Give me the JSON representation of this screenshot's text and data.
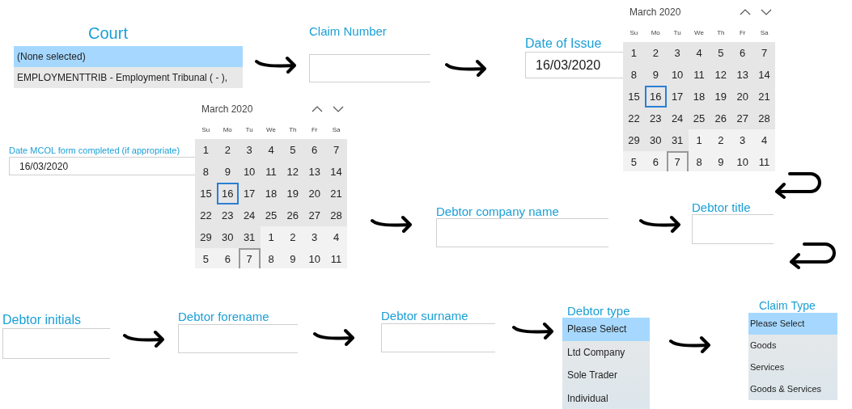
{
  "court": {
    "label": "Court",
    "options": [
      {
        "label": "(None selected)",
        "selected": true
      },
      {
        "label": "EMPLOYMENTTRIB - Employment Tribunal ( - ),",
        "selected": false
      }
    ]
  },
  "claim_number": {
    "label": "Claim Number"
  },
  "date_of_issue": {
    "label": "Date of Issue",
    "value": "16/03/2020"
  },
  "date_of_issue_calendar": {
    "month": "March 2020",
    "weekdays": [
      "Su",
      "Mo",
      "Tu",
      "We",
      "Th",
      "Fr",
      "Sa"
    ],
    "days": [
      {
        "label": "1",
        "in_month": true,
        "selected": false,
        "focused": false
      },
      {
        "label": "2",
        "in_month": true,
        "selected": false,
        "focused": false
      },
      {
        "label": "3",
        "in_month": true,
        "selected": false,
        "focused": false
      },
      {
        "label": "4",
        "in_month": true,
        "selected": false,
        "focused": false
      },
      {
        "label": "5",
        "in_month": true,
        "selected": false,
        "focused": false
      },
      {
        "label": "6",
        "in_month": true,
        "selected": false,
        "focused": false
      },
      {
        "label": "7",
        "in_month": true,
        "selected": false,
        "focused": false
      },
      {
        "label": "8",
        "in_month": true,
        "selected": false,
        "focused": false
      },
      {
        "label": "9",
        "in_month": true,
        "selected": false,
        "focused": false
      },
      {
        "label": "10",
        "in_month": true,
        "selected": false,
        "focused": false
      },
      {
        "label": "11",
        "in_month": true,
        "selected": false,
        "focused": false
      },
      {
        "label": "12",
        "in_month": true,
        "selected": false,
        "focused": false
      },
      {
        "label": "13",
        "in_month": true,
        "selected": false,
        "focused": false
      },
      {
        "label": "14",
        "in_month": true,
        "selected": false,
        "focused": false
      },
      {
        "label": "15",
        "in_month": true,
        "selected": false,
        "focused": false
      },
      {
        "label": "16",
        "in_month": true,
        "selected": true,
        "focused": false
      },
      {
        "label": "17",
        "in_month": true,
        "selected": false,
        "focused": false
      },
      {
        "label": "18",
        "in_month": true,
        "selected": false,
        "focused": false
      },
      {
        "label": "19",
        "in_month": true,
        "selected": false,
        "focused": false
      },
      {
        "label": "20",
        "in_month": true,
        "selected": false,
        "focused": false
      },
      {
        "label": "21",
        "in_month": true,
        "selected": false,
        "focused": false
      },
      {
        "label": "22",
        "in_month": true,
        "selected": false,
        "focused": false
      },
      {
        "label": "23",
        "in_month": true,
        "selected": false,
        "focused": false
      },
      {
        "label": "24",
        "in_month": true,
        "selected": false,
        "focused": false
      },
      {
        "label": "25",
        "in_month": true,
        "selected": false,
        "focused": false
      },
      {
        "label": "26",
        "in_month": true,
        "selected": false,
        "focused": false
      },
      {
        "label": "27",
        "in_month": true,
        "selected": false,
        "focused": false
      },
      {
        "label": "28",
        "in_month": true,
        "selected": false,
        "focused": false
      },
      {
        "label": "29",
        "in_month": true,
        "selected": false,
        "focused": false
      },
      {
        "label": "30",
        "in_month": true,
        "selected": false,
        "focused": false
      },
      {
        "label": "31",
        "in_month": true,
        "selected": false,
        "focused": false
      },
      {
        "label": "1",
        "in_month": false,
        "selected": false,
        "focused": false
      },
      {
        "label": "2",
        "in_month": false,
        "selected": false,
        "focused": false
      },
      {
        "label": "3",
        "in_month": false,
        "selected": false,
        "focused": false
      },
      {
        "label": "4",
        "in_month": false,
        "selected": false,
        "focused": false
      },
      {
        "label": "5",
        "in_month": false,
        "selected": false,
        "focused": false
      },
      {
        "label": "6",
        "in_month": false,
        "selected": false,
        "focused": false
      },
      {
        "label": "7",
        "in_month": false,
        "selected": false,
        "focused": true
      },
      {
        "label": "8",
        "in_month": false,
        "selected": false,
        "focused": false
      },
      {
        "label": "9",
        "in_month": false,
        "selected": false,
        "focused": false
      },
      {
        "label": "10",
        "in_month": false,
        "selected": false,
        "focused": false
      },
      {
        "label": "11",
        "in_month": false,
        "selected": false,
        "focused": false
      }
    ]
  },
  "mcol_date": {
    "label": "Date MCOL form completed (if appropriate)",
    "value": "16/03/2020"
  },
  "mcol_calendar": {
    "month": "March 2020",
    "weekdays": [
      "Su",
      "Mo",
      "Tu",
      "We",
      "Th",
      "Fr",
      "Sa"
    ],
    "days": [
      {
        "label": "1",
        "in_month": true,
        "selected": false,
        "focused": false
      },
      {
        "label": "2",
        "in_month": true,
        "selected": false,
        "focused": false
      },
      {
        "label": "3",
        "in_month": true,
        "selected": false,
        "focused": false
      },
      {
        "label": "4",
        "in_month": true,
        "selected": false,
        "focused": false
      },
      {
        "label": "5",
        "in_month": true,
        "selected": false,
        "focused": false
      },
      {
        "label": "6",
        "in_month": true,
        "selected": false,
        "focused": false
      },
      {
        "label": "7",
        "in_month": true,
        "selected": false,
        "focused": false
      },
      {
        "label": "8",
        "in_month": true,
        "selected": false,
        "focused": false
      },
      {
        "label": "9",
        "in_month": true,
        "selected": false,
        "focused": false
      },
      {
        "label": "10",
        "in_month": true,
        "selected": false,
        "focused": false
      },
      {
        "label": "11",
        "in_month": true,
        "selected": false,
        "focused": false
      },
      {
        "label": "12",
        "in_month": true,
        "selected": false,
        "focused": false
      },
      {
        "label": "13",
        "in_month": true,
        "selected": false,
        "focused": false
      },
      {
        "label": "14",
        "in_month": true,
        "selected": false,
        "focused": false
      },
      {
        "label": "15",
        "in_month": true,
        "selected": false,
        "focused": false
      },
      {
        "label": "16",
        "in_month": true,
        "selected": true,
        "focused": false
      },
      {
        "label": "17",
        "in_month": true,
        "selected": false,
        "focused": false
      },
      {
        "label": "18",
        "in_month": true,
        "selected": false,
        "focused": false
      },
      {
        "label": "19",
        "in_month": true,
        "selected": false,
        "focused": false
      },
      {
        "label": "20",
        "in_month": true,
        "selected": false,
        "focused": false
      },
      {
        "label": "21",
        "in_month": true,
        "selected": false,
        "focused": false
      },
      {
        "label": "22",
        "in_month": true,
        "selected": false,
        "focused": false
      },
      {
        "label": "23",
        "in_month": true,
        "selected": false,
        "focused": false
      },
      {
        "label": "24",
        "in_month": true,
        "selected": false,
        "focused": false
      },
      {
        "label": "25",
        "in_month": true,
        "selected": false,
        "focused": false
      },
      {
        "label": "26",
        "in_month": true,
        "selected": false,
        "focused": false
      },
      {
        "label": "27",
        "in_month": true,
        "selected": false,
        "focused": false
      },
      {
        "label": "28",
        "in_month": true,
        "selected": false,
        "focused": false
      },
      {
        "label": "29",
        "in_month": true,
        "selected": false,
        "focused": false
      },
      {
        "label": "30",
        "in_month": true,
        "selected": false,
        "focused": false
      },
      {
        "label": "31",
        "in_month": true,
        "selected": false,
        "focused": false
      },
      {
        "label": "1",
        "in_month": false,
        "selected": false,
        "focused": false
      },
      {
        "label": "2",
        "in_month": false,
        "selected": false,
        "focused": false
      },
      {
        "label": "3",
        "in_month": false,
        "selected": false,
        "focused": false
      },
      {
        "label": "4",
        "in_month": false,
        "selected": false,
        "focused": false
      },
      {
        "label": "5",
        "in_month": false,
        "selected": false,
        "focused": false
      },
      {
        "label": "6",
        "in_month": false,
        "selected": false,
        "focused": false
      },
      {
        "label": "7",
        "in_month": false,
        "selected": false,
        "focused": true
      },
      {
        "label": "8",
        "in_month": false,
        "selected": false,
        "focused": false
      },
      {
        "label": "9",
        "in_month": false,
        "selected": false,
        "focused": false
      },
      {
        "label": "10",
        "in_month": false,
        "selected": false,
        "focused": false
      },
      {
        "label": "11",
        "in_month": false,
        "selected": false,
        "focused": false
      }
    ]
  },
  "debtor_company_name": {
    "label": "Debtor company name"
  },
  "debtor_title": {
    "label": "Debtor title"
  },
  "debtor_initials": {
    "label": "Debtor initials"
  },
  "debtor_forename": {
    "label": "Debtor forename"
  },
  "debtor_surname": {
    "label": "Debtor surname"
  },
  "debtor_type": {
    "label": "Debtor type",
    "options": [
      {
        "label": "Please Select",
        "selected": true
      },
      {
        "label": "Ltd Company",
        "selected": false
      },
      {
        "label": "Sole Trader",
        "selected": false
      },
      {
        "label": "Individual",
        "selected": false
      }
    ]
  },
  "claim_type": {
    "label": "Claim Type",
    "options": [
      {
        "label": "Please Select",
        "selected": true
      },
      {
        "label": "Goods",
        "selected": false
      },
      {
        "label": "Services",
        "selected": false
      },
      {
        "label": "Goods & Services",
        "selected": false
      }
    ]
  }
}
